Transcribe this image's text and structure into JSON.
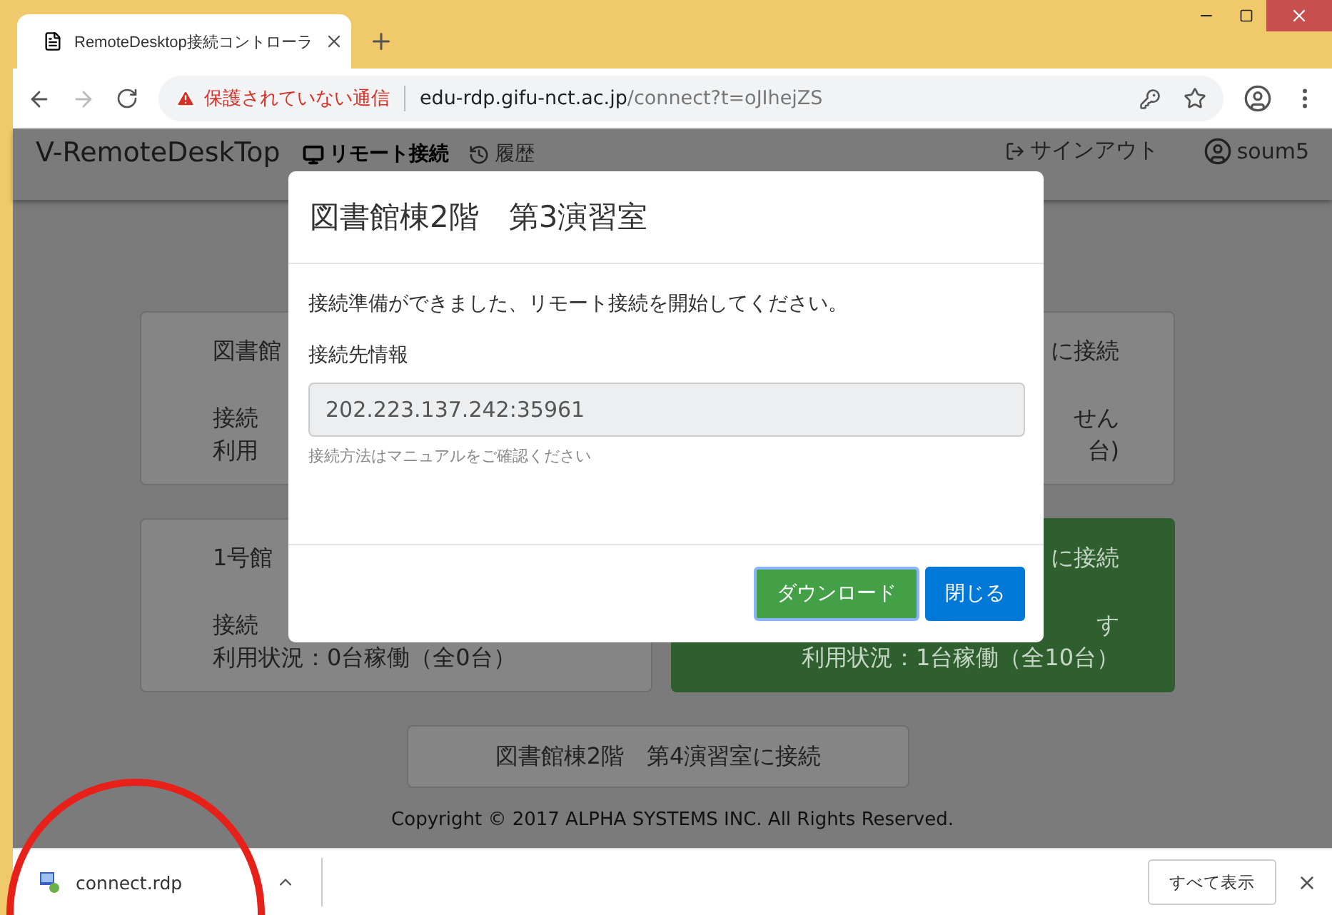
{
  "browser": {
    "tab_title": "RemoteDesktop接続コントローラ",
    "security_label": "保護されていない通信",
    "host": "edu-rdp.gifu-nct.ac.jp",
    "path": "/connect?t=oJIhejZS"
  },
  "navbar": {
    "brand": "V-RemoteDeskTop",
    "items": [
      {
        "label": "リモート接続",
        "selected": true
      },
      {
        "label": "履歴",
        "selected": false
      }
    ],
    "signout": "サインアウト",
    "user": "soum5"
  },
  "cards": [
    {
      "kind": "default",
      "lines": [
        "図書館",
        "接続",
        "利用"
      ]
    },
    {
      "kind": "default",
      "lines": [
        "に接続",
        "せん",
        "台)"
      ]
    },
    {
      "kind": "default",
      "lines": [
        "1号館",
        "接続",
        "利用状況：0台稼働（全0台）"
      ]
    },
    {
      "kind": "success",
      "lines": [
        "に接続",
        "す",
        "利用状況：1台稼働（全10台）"
      ]
    }
  ],
  "bottom_card": "図書館棟2階　第4演習室に接続",
  "footer": "Copyright © 2017 ALPHA SYSTEMS INC. All Rights Reserved.",
  "modal": {
    "title": "図書館棟2階　第3演習室",
    "message": "接続準備ができました、リモート接続を開始してください。",
    "field_label": "接続先情報",
    "field_value": "202.223.137.242:35961",
    "help": "接続方法はマニュアルをご確認ください",
    "buttons": [
      {
        "label": "ダウンロード",
        "kind": "success",
        "focused": true
      },
      {
        "label": "閉じる",
        "kind": "primary",
        "focused": false
      }
    ]
  },
  "downloads": {
    "file": "connect.rdp",
    "show_all": "すべて表示"
  }
}
